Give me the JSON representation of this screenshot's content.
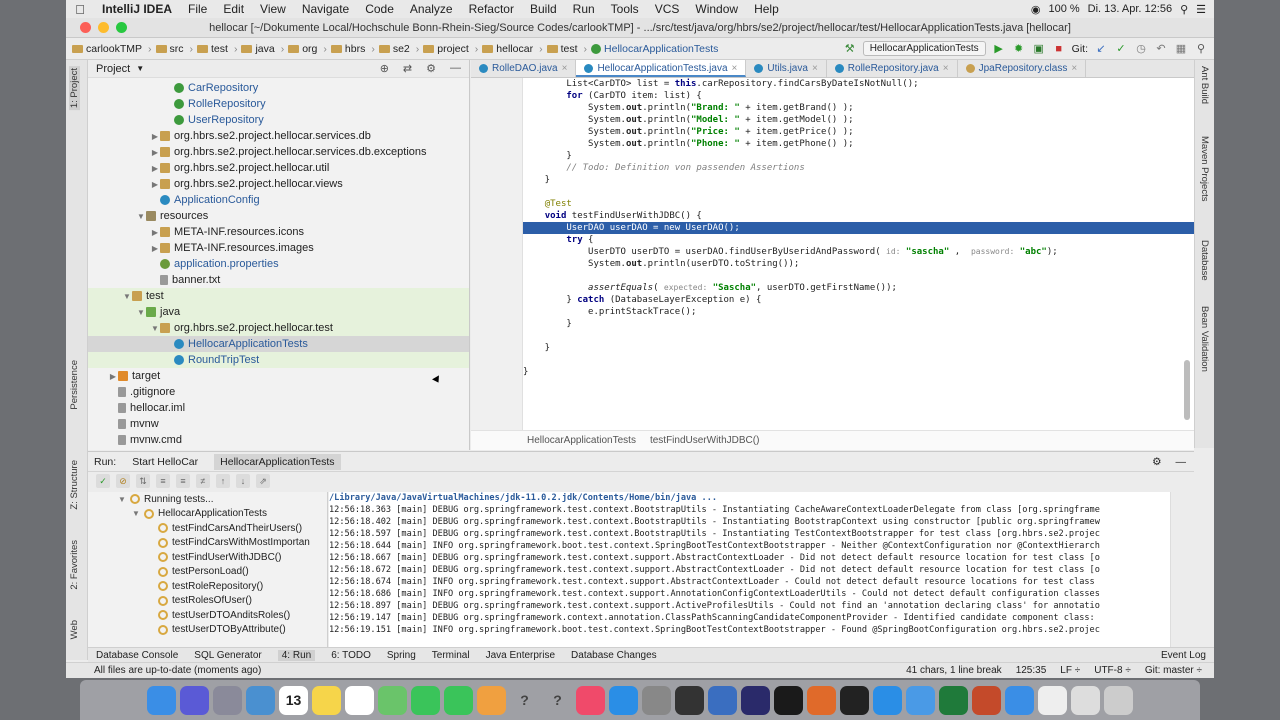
{
  "menubar": {
    "app": "IntelliJ IDEA",
    "items": [
      "File",
      "Edit",
      "View",
      "Navigate",
      "Code",
      "Analyze",
      "Refactor",
      "Build",
      "Run",
      "Tools",
      "VCS",
      "Window",
      "Help"
    ],
    "battery": "100 %",
    "datetime": "Di. 13. Apr. 12:56"
  },
  "window": {
    "title": "hellocar [~/Dokumente Local/Hochschule Bonn-Rhein-Sieg/Source Codes/carlookTMP] - .../src/test/java/org/hbrs/se2/project/hellocar/test/HellocarApplicationTests.java [hellocar]"
  },
  "navbar": {
    "crumbs": [
      "carlookTMP",
      "src",
      "test",
      "java",
      "org",
      "hbrs",
      "se2",
      "project",
      "hellocar",
      "test",
      "HellocarApplicationTests"
    ],
    "run_config": "HellocarApplicationTests",
    "git_label": "Git:"
  },
  "left_strip": {
    "project": "1: Project",
    "persistence": "Persistence",
    "structure": "Z: Structure",
    "favorites": "2: Favorites",
    "web": "Web"
  },
  "right_strip": {
    "ant": "Ant Build",
    "maven": "Maven Projects",
    "database": "Database",
    "bean": "Bean Validation"
  },
  "project_panel": {
    "header": "Project",
    "rows": [
      {
        "indent": 5,
        "label": "CarRepository",
        "kind": "iface",
        "arrow": ""
      },
      {
        "indent": 5,
        "label": "RolleRepository",
        "kind": "iface",
        "arrow": ""
      },
      {
        "indent": 5,
        "label": "UserRepository",
        "kind": "iface",
        "arrow": ""
      },
      {
        "indent": 4,
        "label": "org.hbrs.se2.project.hellocar.services.db",
        "kind": "pkg",
        "arrow": "▶"
      },
      {
        "indent": 4,
        "label": "org.hbrs.se2.project.hellocar.services.db.exceptions",
        "kind": "pkg",
        "arrow": "▶"
      },
      {
        "indent": 4,
        "label": "org.hbrs.se2.project.hellocar.util",
        "kind": "pkg",
        "arrow": "▶"
      },
      {
        "indent": 4,
        "label": "org.hbrs.se2.project.hellocar.views",
        "kind": "pkg",
        "arrow": "▶"
      },
      {
        "indent": 4,
        "label": "ApplicationConfig",
        "kind": "class",
        "arrow": ""
      },
      {
        "indent": 3,
        "label": "resources",
        "kind": "res",
        "arrow": "▼"
      },
      {
        "indent": 4,
        "label": "META-INF.resources.icons",
        "kind": "pkg",
        "arrow": "▶"
      },
      {
        "indent": 4,
        "label": "META-INF.resources.images",
        "kind": "pkg",
        "arrow": "▶"
      },
      {
        "indent": 4,
        "label": "application.properties",
        "kind": "props",
        "arrow": ""
      },
      {
        "indent": 4,
        "label": "banner.txt",
        "kind": "file",
        "arrow": ""
      },
      {
        "indent": 2,
        "label": "test",
        "kind": "folder",
        "arrow": "▼"
      },
      {
        "indent": 3,
        "label": "java",
        "kind": "folder-green",
        "arrow": "▼"
      },
      {
        "indent": 4,
        "label": "org.hbrs.se2.project.hellocar.test",
        "kind": "pkg",
        "arrow": "▼"
      },
      {
        "indent": 5,
        "label": "HellocarApplicationTests",
        "kind": "class",
        "arrow": ""
      },
      {
        "indent": 5,
        "label": "RoundTripTest",
        "kind": "class",
        "arrow": ""
      },
      {
        "indent": 1,
        "label": "target",
        "kind": "folder-orange",
        "arrow": "▶"
      },
      {
        "indent": 1,
        "label": ".gitignore",
        "kind": "file",
        "arrow": ""
      },
      {
        "indent": 1,
        "label": "hellocar.iml",
        "kind": "file",
        "arrow": ""
      },
      {
        "indent": 1,
        "label": "mvnw",
        "kind": "file",
        "arrow": ""
      },
      {
        "indent": 1,
        "label": "mvnw.cmd",
        "kind": "file",
        "arrow": ""
      },
      {
        "indent": 1,
        "label": "package.json",
        "kind": "file",
        "arrow": ""
      }
    ]
  },
  "editor": {
    "tabs": [
      "RolleDAO.java",
      "HellocarApplicationTests.java",
      "Utils.java",
      "RolleRepository.java",
      "JpaRepository.class"
    ],
    "active_tab": 1,
    "breadcrumb": [
      "HellocarApplicationTests",
      "testFindUserWithJDBC()"
    ],
    "lines": [
      {
        "n": "113",
        "html": "        List&lt;CarDTO&gt; list = <span class=\"kw\">this</span>.carRepository.findCarsByDateIsNotNull();"
      },
      {
        "n": "114",
        "html": "        <span class=\"kw\">for</span> (CarDTO item: list) {"
      },
      {
        "n": "115",
        "html": "            System.<b>out</b>.println(<span class=\"str\">\"Brand: \"</span> + item.getBrand() );"
      },
      {
        "n": "116",
        "html": "            System.<b>out</b>.println(<span class=\"str\">\"Model: \"</span> + item.getModel() );"
      },
      {
        "n": "117",
        "html": "            System.<b>out</b>.println(<span class=\"str\">\"Price: \"</span> + item.getPrice() );"
      },
      {
        "n": "118",
        "html": "            System.<b>out</b>.println(<span class=\"str\">\"Phone: \"</span> + item.getPhone() );"
      },
      {
        "n": "119",
        "html": "        }"
      },
      {
        "n": "120",
        "html": "        <span class=\"cmt\">// Todo: Definition von passenden Assertions</span>"
      },
      {
        "n": "121",
        "html": "    }"
      },
      {
        "n": "122",
        "html": ""
      },
      {
        "n": "123",
        "html": "    <span class=\"ann\">@Test</span>"
      },
      {
        "n": "124",
        "html": "    <span class=\"kw\">void</span> testFindUserWithJDBC() {"
      },
      {
        "n": "125",
        "html": "        UserDAO userDAO = new UserDAO();",
        "current": true
      },
      {
        "n": "126",
        "html": "        <span class=\"kw\">try</span> {"
      },
      {
        "n": "127",
        "html": "            UserDTO userDTO = userDAO.findUserByUseridAndPassword( <span class=\"hint\">id:</span> <span class=\"str\">\"sascha\"</span> ,  <span class=\"hint\">password:</span> <span class=\"str\">\"abc\"</span>);"
      },
      {
        "n": "128",
        "html": "            System.<b>out</b>.println(userDTO.toString());"
      },
      {
        "n": "129",
        "html": ""
      },
      {
        "n": "130",
        "html": "            <i>assertEquals</i>( <span class=\"hint\">expected:</span> <span class=\"str\">\"Sascha\"</span>, userDTO.getFirstName());"
      },
      {
        "n": "131",
        "html": "        } <span class=\"kw\">catch</span> (DatabaseLayerException e) {"
      },
      {
        "n": "132",
        "html": "            e.printStackTrace();"
      },
      {
        "n": "133",
        "html": "        }"
      },
      {
        "n": "134",
        "html": ""
      },
      {
        "n": "135",
        "html": "    }"
      },
      {
        "n": "136",
        "html": ""
      },
      {
        "n": "137",
        "html": "}"
      },
      {
        "n": "138",
        "html": ""
      }
    ]
  },
  "run_panel": {
    "label": "Run:",
    "tabs": [
      "Start HelloCar",
      "HellocarApplicationTests"
    ],
    "active_tab": 1,
    "tree": [
      {
        "indent": 0,
        "label": "Running tests...",
        "arrow": "▼"
      },
      {
        "indent": 1,
        "label": "HellocarApplicationTests",
        "arrow": "▼"
      },
      {
        "indent": 2,
        "label": "testFindCarsAndTheirUsers()",
        "arrow": ""
      },
      {
        "indent": 2,
        "label": "testFindCarsWithMostImportan",
        "arrow": ""
      },
      {
        "indent": 2,
        "label": "testFindUserWithJDBC()",
        "arrow": ""
      },
      {
        "indent": 2,
        "label": "testPersonLoad()",
        "arrow": ""
      },
      {
        "indent": 2,
        "label": "testRoleRepository()",
        "arrow": ""
      },
      {
        "indent": 2,
        "label": "testRolesOfUser()",
        "arrow": ""
      },
      {
        "indent": 2,
        "label": "testUserDTOAnditsRoles()",
        "arrow": ""
      },
      {
        "indent": 2,
        "label": "testUserDTOByAttribute()",
        "arrow": ""
      }
    ],
    "console": [
      "/Library/Java/JavaVirtualMachines/jdk-11.0.2.jdk/Contents/Home/bin/java ...",
      "12:56:18.363 [main] DEBUG org.springframework.test.context.BootstrapUtils - Instantiating CacheAwareContextLoaderDelegate from class [org.springframe",
      "12:56:18.402 [main] DEBUG org.springframework.test.context.BootstrapUtils - Instantiating BootstrapContext using constructor [public org.springframew",
      "12:56:18.597 [main] DEBUG org.springframework.test.context.BootstrapUtils - Instantiating TestContextBootstrapper for test class [org.hbrs.se2.projec",
      "12:56:18.644 [main] INFO org.springframework.boot.test.context.SpringBootTestContextBootstrapper - Neither @ContextConfiguration nor @ContextHierarch",
      "12:56:18.667 [main] DEBUG org.springframework.test.context.support.AbstractContextLoader - Did not detect default resource location for test class [o",
      "12:56:18.672 [main] DEBUG org.springframework.test.context.support.AbstractContextLoader - Did not detect default resource location for test class [o",
      "12:56:18.674 [main] INFO org.springframework.test.context.support.AbstractContextLoader - Could not detect default resource locations for test class",
      "12:56:18.686 [main] INFO org.springframework.test.context.support.AnnotationConfigContextLoaderUtils - Could not detect default configuration classes",
      "12:56:18.897 [main] DEBUG org.springframework.test.context.support.ActiveProfilesUtils - Could not find an 'annotation declaring class' for annotatio",
      "12:56:19.147 [main] DEBUG org.springframework.context.annotation.ClassPathScanningCandidateComponentProvider - Identified candidate component class:",
      "12:56:19.151 [main] INFO org.springframework.boot.test.context.SpringBootTestContextBootstrapper - Found @SpringBootConfiguration org.hbrs.se2.projec"
    ]
  },
  "bottom_tabs": [
    "Database Console",
    "SQL Generator",
    "4: Run",
    "6: TODO",
    "Spring",
    "Terminal",
    "Java Enterprise",
    "Database Changes"
  ],
  "bottom_active": 2,
  "event_log": "Event Log",
  "status": {
    "message": "All files are up-to-date (moments ago)",
    "chars": "41 chars, 1 line break",
    "position": "125:35",
    "line_sep": "LF ÷",
    "encoding": "UTF-8 ÷",
    "git": "Git: master ÷"
  },
  "dock": {
    "calendar_day": "13",
    "icons": [
      "finder",
      "siri",
      "launchpad",
      "preview",
      "calendar",
      "notes",
      "reminders",
      "maps",
      "messages",
      "facetime",
      "photos",
      "help",
      "help",
      "music",
      "app-store",
      "settings",
      "activity-monitor",
      "virtualbox",
      "eclipse",
      "intellij",
      "firefox",
      "terminal",
      "zoom",
      "chrome",
      "excel",
      "powerpoint",
      "safari",
      "textedit",
      "documents",
      "trash"
    ]
  },
  "colors": {
    "accent": "#2c5ea8",
    "selection": "#d6d6d6",
    "test_bg": "#e6f2dc"
  }
}
